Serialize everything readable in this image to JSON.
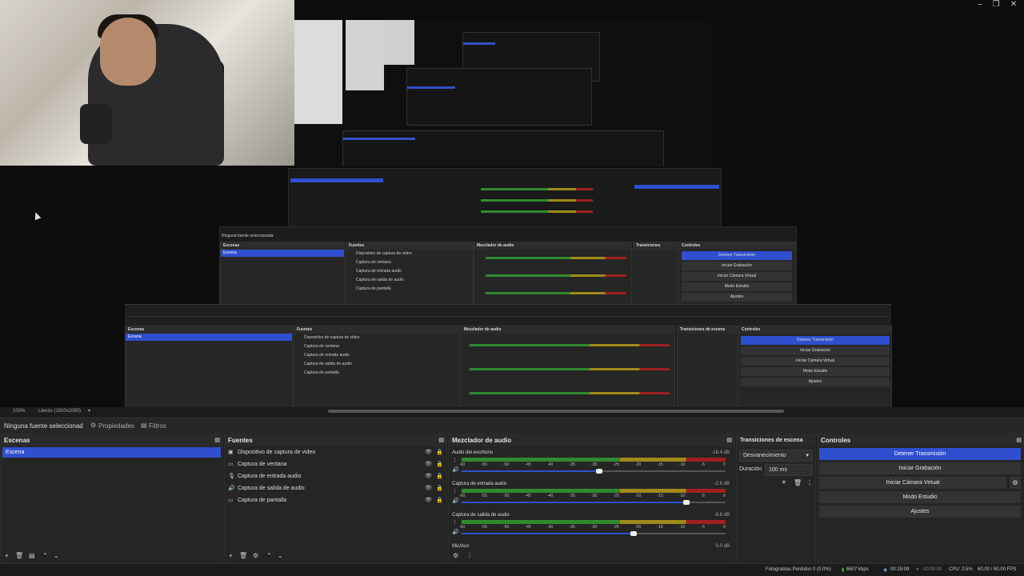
{
  "window": {
    "minimize": "–",
    "restore": "❐",
    "close": "✕"
  },
  "canvas": {
    "zoom": "100%",
    "canvas_label": "Lienzo (1920x1080)"
  },
  "source_toolbar": {
    "no_source": "Ninguna fuente seleccionad",
    "properties": "Propiedades",
    "filters": "Filtros"
  },
  "scenes": {
    "title": "Escenas",
    "items": [
      "Escena"
    ]
  },
  "sources": {
    "title": "Fuentes",
    "items": [
      {
        "icon": "camera-icon",
        "label": "Dispositivo de captura de video"
      },
      {
        "icon": "window-icon",
        "label": "Captura de ventana"
      },
      {
        "icon": "microphone-icon",
        "label": "Captura de entrada audio"
      },
      {
        "icon": "speaker-icon",
        "label": "Captura de salida de audio"
      },
      {
        "icon": "monitor-icon",
        "label": "Captura de pantalla"
      }
    ]
  },
  "mixer": {
    "title": "Mezclador de audio",
    "scale": [
      "-60",
      "-55",
      "-50",
      "-45",
      "-40",
      "-35",
      "-30",
      "-25",
      "-20",
      "-15",
      "-10",
      "-5",
      "0"
    ],
    "channels": [
      {
        "name": "Audio del escritorio",
        "db": "-18.4 dB",
        "level": 0.52
      },
      {
        "name": "Captura de entrada audio",
        "db": "-2.8 dB",
        "level": 0.85
      },
      {
        "name": "Captura de salida de audio",
        "db": "-9.6 dB",
        "level": 0.65
      },
      {
        "name": "Mic/Aux",
        "db": "0.0 dB",
        "level": 0.0
      }
    ]
  },
  "transitions": {
    "title": "Transiciones de escena",
    "type": "Desvanecimiento",
    "duration_label": "Duración",
    "duration": "100 ms"
  },
  "controls": {
    "title": "Controles",
    "stop_stream": "Detener Transmisión",
    "start_recording": "Iniciar Grabación",
    "start_virtual_cam": "Iniciar Cámara Virtual",
    "studio_mode": "Modo Estudio",
    "settings": "Ajustes"
  },
  "status": {
    "dropped": "Fotogramas Perdidos 0 (0.0%)",
    "bitrate": "6607 kbps",
    "stream_time": "00:15:09",
    "rec_time": "00:00:00",
    "cpu": "CPU: 2.5%",
    "fps": "60.00 / 60.00 FPS"
  },
  "colors": {
    "accent": "#2f4fcf",
    "panel": "#252525",
    "background": "#1e1e1e"
  }
}
